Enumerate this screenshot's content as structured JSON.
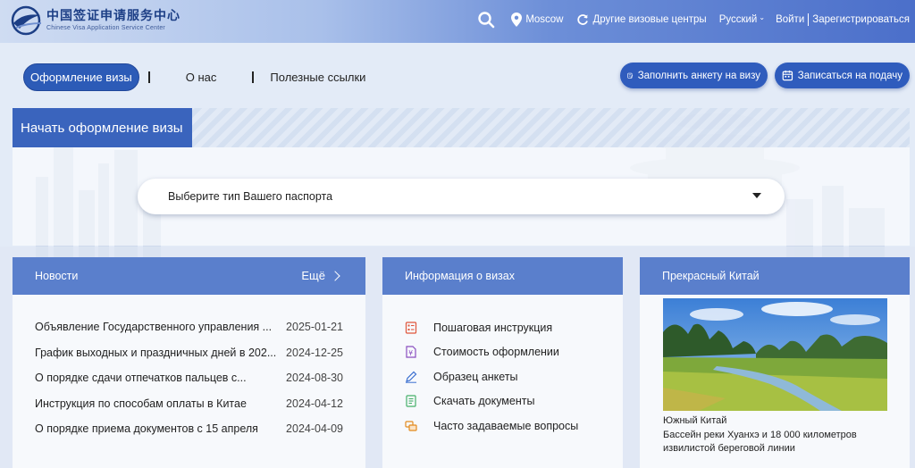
{
  "header": {
    "logo_cn": "中国签证申请服务中心",
    "logo_en": "Chinese Visa Application Service Center",
    "location": "Moscow",
    "other_centers": "Другие визовые центры",
    "language": "Русский",
    "login": "Войти",
    "register": "Зарегистрироваться"
  },
  "nav": {
    "apply": "Оформление визы",
    "about": "О нас",
    "links": "Полезные ссылки"
  },
  "actions": {
    "fill_form": "Заполнить анкету на визу",
    "book": "Записаться на подачу"
  },
  "start": {
    "title": "Начать оформление визы",
    "passport_placeholder": "Выберите тип Вашего паспорта"
  },
  "news": {
    "title": "Новости",
    "more": "Ещё",
    "items": [
      {
        "title": "Объявление Государственного управления ...",
        "date": "2025-01-21"
      },
      {
        "title": "График выходных и праздничных дней в 202...",
        "date": "2024-12-25"
      },
      {
        "title": "О порядке сдачи отпечатков пальцев с...",
        "date": "2024-08-30"
      },
      {
        "title": "Инструкция по способам оплаты в Китае",
        "date": "2024-04-12"
      },
      {
        "title": "О порядке приема документов с 15 апреля",
        "date": "2024-04-09"
      }
    ]
  },
  "visa_info": {
    "title": "Информация о визах",
    "items": [
      {
        "label": "Пошаговая инструкция",
        "icon": "checklist-icon"
      },
      {
        "label": "Стоимость оформлении",
        "icon": "price-document-icon"
      },
      {
        "label": "Образец анкеты",
        "icon": "pen-icon"
      },
      {
        "label": "Скачать документы",
        "icon": "document-download-icon"
      },
      {
        "label": "Часто задаваемые вопросы",
        "icon": "faq-chat-icon"
      }
    ]
  },
  "beautiful_china": {
    "title": "Прекрасный Китай",
    "caption_title": "Южный Китай",
    "caption_text": "Бассейн реки Хуанхэ и 18 000 километров извилистой береговой линии"
  },
  "colors": {
    "primary": "#2c5bb7",
    "card_header": "#5a7fcc",
    "icon_red": "#e0563b",
    "icon_purple": "#8a4fc0",
    "icon_blue": "#3a6fd0",
    "icon_green": "#45b06a",
    "icon_orange": "#e38a1e"
  }
}
